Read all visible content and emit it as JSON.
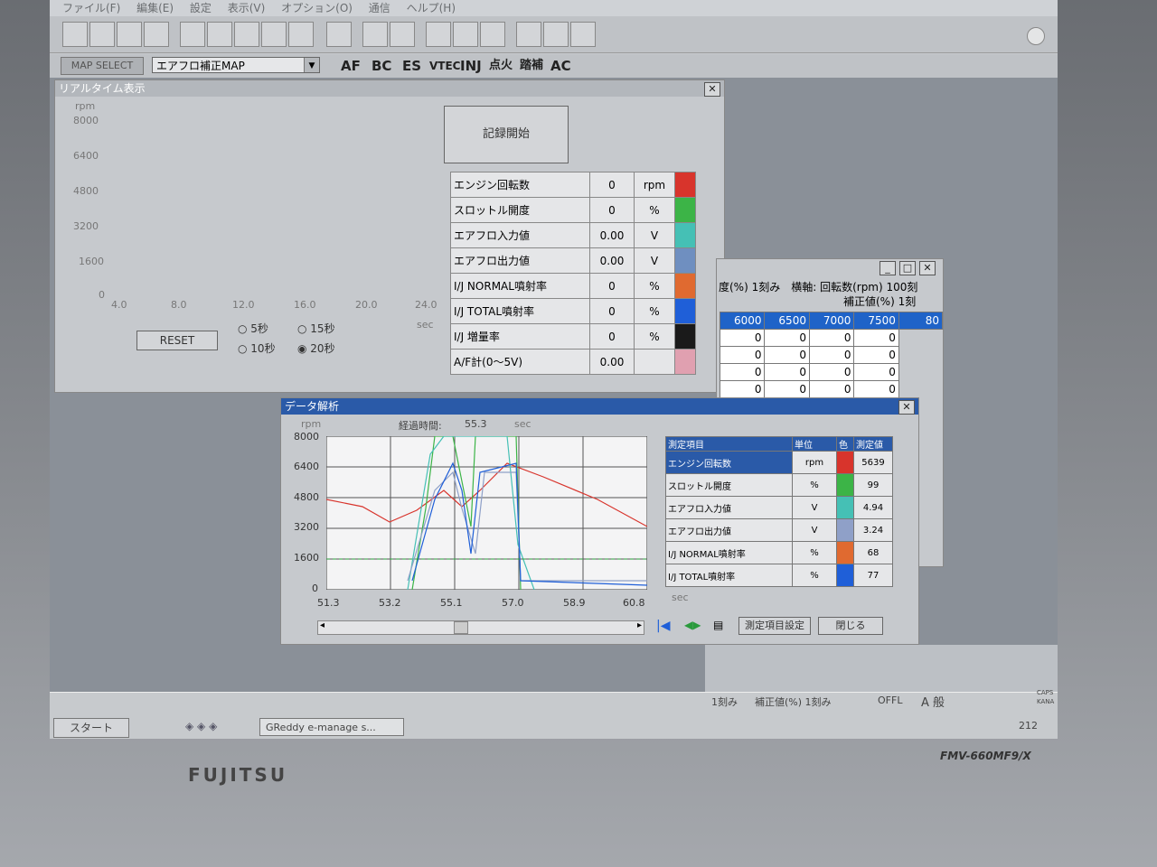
{
  "menu": [
    "ファイル(F)",
    "編集(E)",
    "設定",
    "表示(V)",
    "オプション(O)",
    "通信",
    "ヘルプ(H)"
  ],
  "toolbar2": {
    "map_select": "MAP SELECT",
    "map_combo": "エアフロ補正MAP",
    "mode_buttons": [
      "AF",
      "BC",
      "ES",
      "VTEC",
      "INJ",
      "点火",
      "踏補",
      "AC"
    ]
  },
  "realtime": {
    "title": "リアルタイム表示",
    "unit": "rpm",
    "y_ticks": [
      "8000",
      "6400",
      "4800",
      "3200",
      "1600",
      "0"
    ],
    "x_ticks": [
      "4.0",
      "8.0",
      "12.0",
      "16.0",
      "20.0",
      "24.0"
    ],
    "x_unit": "sec",
    "record_button": "記録開始",
    "reset_button": "RESET",
    "radios": [
      "5秒",
      "15秒",
      "10秒",
      "20秒"
    ],
    "selected_radio": "20秒",
    "params": [
      {
        "name": "エンジン回転数",
        "value": "0",
        "unit": "rpm",
        "color": "#d8342c"
      },
      {
        "name": "スロットル開度",
        "value": "0",
        "unit": "%",
        "color": "#3cb447"
      },
      {
        "name": "エアフロ入力値",
        "value": "0.00",
        "unit": "V",
        "color": "#45c0b5"
      },
      {
        "name": "エアフロ出力値",
        "value": "0.00",
        "unit": "V",
        "color": "#6f8fc0"
      },
      {
        "name": "I/J NORMAL噴射率",
        "value": "0",
        "unit": "%",
        "color": "#e06a30"
      },
      {
        "name": "I/J TOTAL噴射率",
        "value": "0",
        "unit": "%",
        "color": "#1f5fd8"
      },
      {
        "name": "I/J 増量率",
        "value": "0",
        "unit": "%",
        "color": "#1a1a1a"
      },
      {
        "name": "A/F計(0〜5V)",
        "value": "0.00",
        "unit": "",
        "color": "#e0a0b0"
      }
    ]
  },
  "map_window": {
    "header1": "度(%) 1刻み　横軸: 回転数(rpm) 100刻",
    "header2": "補正値(%) 1刻",
    "columns": [
      "6000",
      "6500",
      "7000",
      "7500",
      "80"
    ],
    "rows": [
      [
        "0",
        "0",
        "0",
        "0"
      ],
      [
        "0",
        "0",
        "0",
        "0"
      ],
      [
        "0",
        "0",
        "0",
        "0"
      ],
      [
        "0",
        "0",
        "0",
        "0"
      ]
    ]
  },
  "analysis": {
    "title": "データ解析",
    "unit": "rpm",
    "elapsed_label": "経過時間:",
    "elapsed_value": "55.3",
    "elapsed_unit": "sec",
    "y_ticks": [
      "8000",
      "6400",
      "4800",
      "3200",
      "1600",
      "0"
    ],
    "x_ticks": [
      "51.3",
      "53.2",
      "55.1",
      "57.0",
      "58.9",
      "60.8"
    ],
    "x_unit": "sec",
    "table_headers": [
      "測定項目",
      "単位",
      "色",
      "測定値"
    ],
    "rows": [
      {
        "name": "エンジン回転数",
        "unit": "rpm",
        "color": "#d8342c",
        "value": "5639"
      },
      {
        "name": "スロットル開度",
        "unit": "%",
        "color": "#3cb447",
        "value": "99"
      },
      {
        "name": "エアフロ入力値",
        "unit": "V",
        "color": "#45c0b5",
        "value": "4.94"
      },
      {
        "name": "エアフロ出力値",
        "unit": "V",
        "color": "#8fa0c8",
        "value": "3.24"
      },
      {
        "name": "I/J NORMAL噴射率",
        "unit": "%",
        "color": "#e06a30",
        "value": "68"
      },
      {
        "name": "I/J TOTAL噴射率",
        "unit": "%",
        "color": "#1f5fd8",
        "value": "77"
      }
    ],
    "settings_button": "測定項目設定",
    "close_button": "閉じる"
  },
  "status": {
    "left": "1刻み",
    "middle": "補正値(%) 1刻み",
    "right": "OFFL",
    "ime": "A 般",
    "caps": "CAPS",
    "kana": "KANA",
    "tray_number": "212"
  },
  "taskbar": {
    "start": "スタート",
    "app": "GReddy e-manage s..."
  },
  "hardware": {
    "brand": "FUJITSU",
    "model": "FMV-660MF9/X"
  }
}
